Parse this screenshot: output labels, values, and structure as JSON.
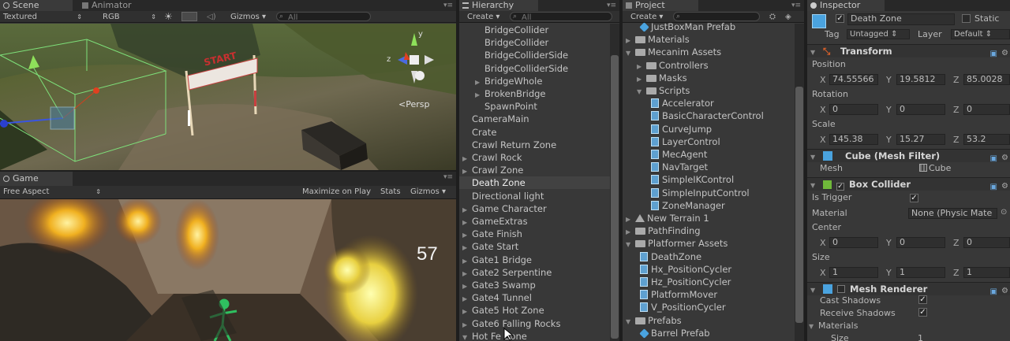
{
  "scene": {
    "tabs": [
      "Scene",
      "Animator"
    ],
    "toolbar": {
      "render_mode": "Textured",
      "color_mode": "RGB",
      "gizmos": "Gizmos",
      "search_placeholder": "All"
    },
    "start_banner": "START",
    "persp_label": "Persp",
    "axis_z": "z",
    "axis_y": "y"
  },
  "game": {
    "tab": "Game",
    "toolbar": {
      "aspect": "Free Aspect",
      "maximize": "Maximize on Play",
      "stats": "Stats",
      "gizmos": "Gizmos"
    },
    "fps_counter": "57"
  },
  "hierarchy": {
    "tab": "Hierarchy",
    "create": "Create",
    "search_placeholder": "All",
    "items": [
      {
        "label": "BridgeCollider",
        "indent": 2,
        "arrow": false
      },
      {
        "label": "BridgeCollider",
        "indent": 2,
        "arrow": false
      },
      {
        "label": "BridgeColliderSide",
        "indent": 2,
        "arrow": false
      },
      {
        "label": "BridgeColliderSide",
        "indent": 2,
        "arrow": false
      },
      {
        "label": "BridgeWhole",
        "indent": 2,
        "arrow": true
      },
      {
        "label": "BrokenBridge",
        "indent": 2,
        "arrow": true
      },
      {
        "label": "SpawnPoint",
        "indent": 2,
        "arrow": false
      },
      {
        "label": "CameraMain",
        "indent": 1,
        "arrow": false
      },
      {
        "label": "Crate",
        "indent": 1,
        "arrow": false
      },
      {
        "label": "Crawl Return Zone",
        "indent": 1,
        "arrow": false
      },
      {
        "label": "Crawl Rock",
        "indent": 1,
        "arrow": true
      },
      {
        "label": "Crawl Zone",
        "indent": 1,
        "arrow": true
      },
      {
        "label": "Death Zone",
        "indent": 1,
        "arrow": false,
        "selected": true
      },
      {
        "label": "Directional light",
        "indent": 1,
        "arrow": false
      },
      {
        "label": "Game Character",
        "indent": 1,
        "arrow": true
      },
      {
        "label": "GameExtras",
        "indent": 1,
        "arrow": true
      },
      {
        "label": "Gate Finish",
        "indent": 1,
        "arrow": true
      },
      {
        "label": "Gate Start",
        "indent": 1,
        "arrow": true
      },
      {
        "label": "Gate1 Bridge",
        "indent": 1,
        "arrow": true
      },
      {
        "label": "Gate2 Serpentine",
        "indent": 1,
        "arrow": true
      },
      {
        "label": "Gate3 Swamp",
        "indent": 1,
        "arrow": true
      },
      {
        "label": "Gate4 Tunnel",
        "indent": 1,
        "arrow": true
      },
      {
        "label": "Gate5 Hot Zone",
        "indent": 1,
        "arrow": true
      },
      {
        "label": "Gate6 Falling Rocks",
        "indent": 1,
        "arrow": true
      },
      {
        "label": "Hot Fe Zone",
        "indent": 1,
        "arrow": true,
        "open": true
      }
    ]
  },
  "project": {
    "tab": "Project",
    "create": "Create",
    "items": [
      {
        "label": "JustBoxMan Prefab",
        "indent": 1,
        "icon": "prefab"
      },
      {
        "label": "Materials",
        "indent": 0,
        "icon": "folder",
        "arrow": "closed"
      },
      {
        "label": "Mecanim Assets",
        "indent": 0,
        "icon": "folder",
        "arrow": "open"
      },
      {
        "label": "Controllers",
        "indent": 1,
        "icon": "folder",
        "arrow": "closed"
      },
      {
        "label": "Masks",
        "indent": 1,
        "icon": "folder",
        "arrow": "closed"
      },
      {
        "label": "Scripts",
        "indent": 1,
        "icon": "folder",
        "arrow": "open"
      },
      {
        "label": "Accelerator",
        "indent": 2,
        "icon": "script"
      },
      {
        "label": "BasicCharacterControl",
        "indent": 2,
        "icon": "script"
      },
      {
        "label": "CurveJump",
        "indent": 2,
        "icon": "script"
      },
      {
        "label": "LayerControl",
        "indent": 2,
        "icon": "script"
      },
      {
        "label": "MecAgent",
        "indent": 2,
        "icon": "script"
      },
      {
        "label": "NavTarget",
        "indent": 2,
        "icon": "script"
      },
      {
        "label": "SimpleIKControl",
        "indent": 2,
        "icon": "script"
      },
      {
        "label": "SimpleInputControl",
        "indent": 2,
        "icon": "script"
      },
      {
        "label": "ZoneManager",
        "indent": 2,
        "icon": "script"
      },
      {
        "label": "New Terrain 1",
        "indent": 0,
        "icon": "terrain",
        "arrow": "closed"
      },
      {
        "label": "PathFinding",
        "indent": 0,
        "icon": "folder",
        "arrow": "closed"
      },
      {
        "label": "Platformer Assets",
        "indent": 0,
        "icon": "folder",
        "arrow": "open"
      },
      {
        "label": "DeathZone",
        "indent": 1,
        "icon": "script"
      },
      {
        "label": "Hx_PositionCycler",
        "indent": 1,
        "icon": "script"
      },
      {
        "label": "Hz_PositionCycler",
        "indent": 1,
        "icon": "script"
      },
      {
        "label": "PlatformMover",
        "indent": 1,
        "icon": "script"
      },
      {
        "label": "V_PositionCycler",
        "indent": 1,
        "icon": "script"
      },
      {
        "label": "Prefabs",
        "indent": 0,
        "icon": "folder",
        "arrow": "open"
      },
      {
        "label": "Barrel Prefab",
        "indent": 1,
        "icon": "prefab"
      }
    ]
  },
  "inspector": {
    "tab": "Inspector",
    "object_name": "Death Zone",
    "static_label": "Static",
    "tag_label": "Tag",
    "tag_value": "Untagged",
    "layer_label": "Layer",
    "layer_value": "Default",
    "transform": {
      "title": "Transform",
      "position_label": "Position",
      "position": {
        "x": "74.55566",
        "y": "19.5812",
        "z": "85.0028"
      },
      "rotation_label": "Rotation",
      "rotation": {
        "x": "0",
        "y": "0",
        "z": "0"
      },
      "scale_label": "Scale",
      "scale": {
        "x": "145.38",
        "y": "15.27",
        "z": "53.2"
      }
    },
    "mesh_filter": {
      "title": "Cube (Mesh Filter)",
      "mesh_label": "Mesh",
      "mesh_value": "Cube"
    },
    "box_collider": {
      "title": "Box Collider",
      "is_trigger_label": "Is Trigger",
      "material_label": "Material",
      "material_value": "None (Physic Mate",
      "center_label": "Center",
      "center": {
        "x": "0",
        "y": "0",
        "z": "0"
      },
      "size_label": "Size",
      "size": {
        "x": "1",
        "y": "1",
        "z": "1"
      }
    },
    "mesh_renderer": {
      "title": "Mesh Renderer",
      "cast_shadows_label": "Cast Shadows",
      "receive_shadows_label": "Receive Shadows",
      "materials_label": "Materials",
      "size_label": "Size",
      "size_value": "1"
    },
    "axis_labels": {
      "x": "X",
      "y": "Y",
      "z": "Z"
    }
  },
  "colors": {
    "panel_bg": "#383838",
    "selection": "#424242",
    "transform_icon": "#d8602a",
    "collider_icon": "#6fb83a",
    "mesh_icon": "#4aa3df"
  }
}
